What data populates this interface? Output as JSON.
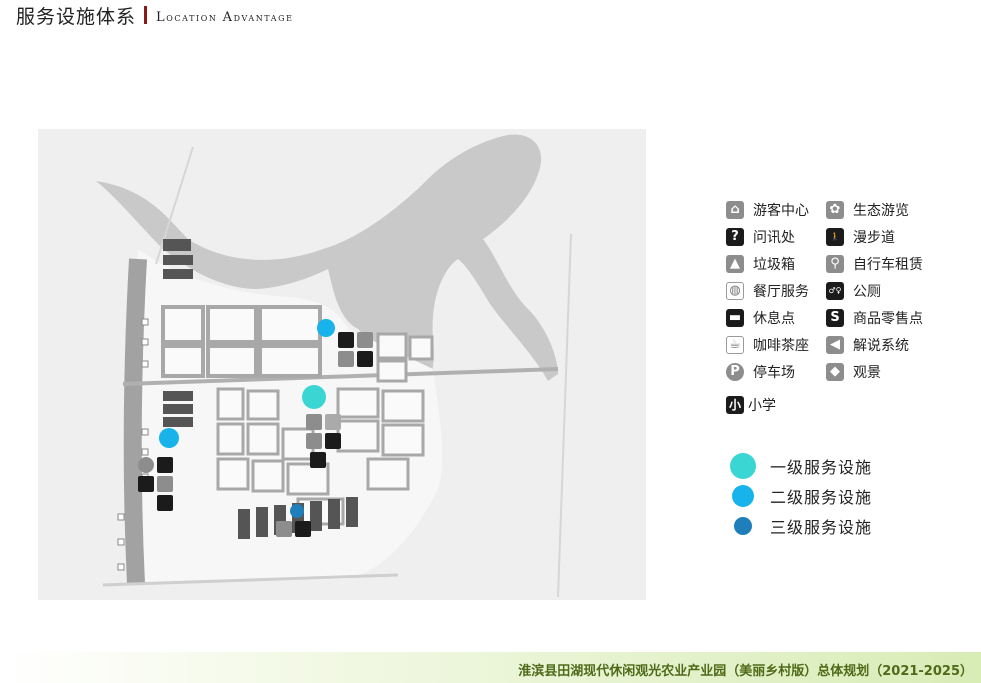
{
  "header": {
    "title": "服务设施体系",
    "subtitle_cap1": "L",
    "subtitle_rest1": "ocation ",
    "subtitle_cap2": "A",
    "subtitle_rest2": "dvantage"
  },
  "legend": {
    "facilities": [
      {
        "label": "游客中心",
        "icon": "visitor-center-icon",
        "glyph": "⌂",
        "style": "gray"
      },
      {
        "label": "生态游览",
        "icon": "eco-tour-icon",
        "glyph": "✿",
        "style": "gray"
      },
      {
        "label": "问讯处",
        "icon": "information-icon",
        "glyph": "?",
        "style": "dark"
      },
      {
        "label": "漫步道",
        "icon": "walking-trail-icon",
        "glyph": "🚶",
        "style": "dark"
      },
      {
        "label": "垃圾箱",
        "icon": "trash-bin-icon",
        "glyph": "▲",
        "style": "gray"
      },
      {
        "label": "自行车租赁",
        "icon": "bike-rental-icon",
        "glyph": "⚲",
        "style": "gray"
      },
      {
        "label": "餐厅服务",
        "icon": "restaurant-icon",
        "glyph": "◍",
        "style": "light"
      },
      {
        "label": "公厕",
        "icon": "restroom-icon",
        "glyph": "♂♀",
        "style": "dark"
      },
      {
        "label": "休息点",
        "icon": "rest-point-icon",
        "glyph": "▬",
        "style": "dark"
      },
      {
        "label": "商品零售点",
        "icon": "retail-icon",
        "glyph": "S",
        "style": "dark"
      },
      {
        "label": "咖啡茶座",
        "icon": "coffee-icon",
        "glyph": "☕",
        "style": "light"
      },
      {
        "label": "解说系统",
        "icon": "interpretation-icon",
        "glyph": "◀",
        "style": "gray"
      },
      {
        "label": "停车场",
        "icon": "parking-icon",
        "glyph": "P",
        "style": "gray-round"
      },
      {
        "label": "观景",
        "icon": "viewpoint-icon",
        "glyph": "◆",
        "style": "gray"
      }
    ],
    "school": {
      "icon_text": "小",
      "label": "小学"
    },
    "levels": [
      {
        "label": "一级服务设施",
        "color": "#3ad6d3"
      },
      {
        "label": "二级服务设施",
        "color": "#17b3ea"
      },
      {
        "label": "三级服务设施",
        "color": "#1f7fba"
      }
    ]
  },
  "map": {
    "colors": {
      "water": "#c8c8c8",
      "land": "#f2f2f2",
      "road": "#9c9c9c",
      "building": "#4a4a4a",
      "level1": "#3ad6d3",
      "level2": "#17b3ea",
      "level3": "#1f7fba"
    }
  },
  "footer": {
    "text": "淮滨县田湖现代休闲观光农业产业园（美丽乡村版）总体规划（2021-2025）"
  }
}
